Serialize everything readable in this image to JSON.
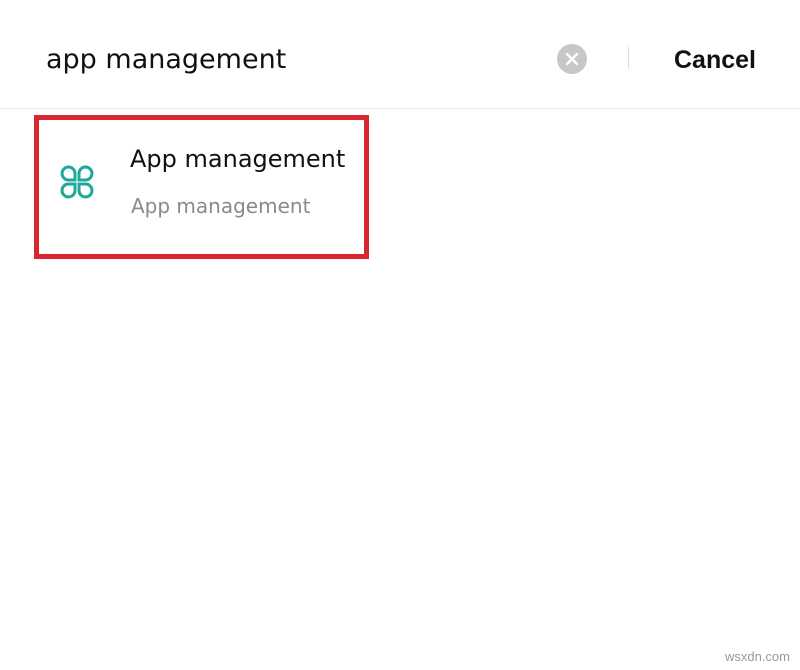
{
  "search": {
    "value": "app management",
    "clear_icon": "close-circle-icon",
    "cancel_label": "Cancel"
  },
  "results": [
    {
      "icon": "app-grid-icon",
      "icon_color": "#1fa898",
      "title": "App management",
      "subtitle": "App management",
      "highlight_color": "#d9262e"
    }
  ],
  "watermark": "wsxdn.com"
}
